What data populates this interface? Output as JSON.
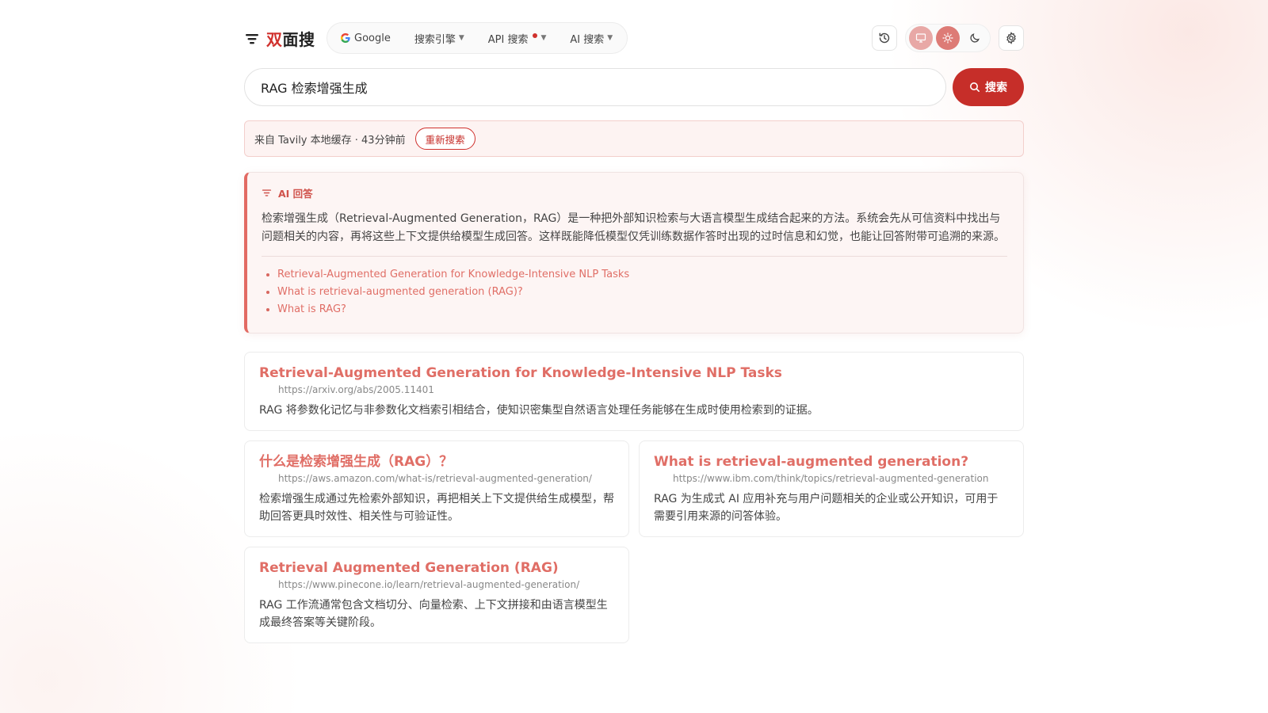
{
  "app": {
    "logo_accent": "双",
    "logo_rest": "面搜"
  },
  "engines": {
    "google": "Google",
    "search_engine": "搜索引擎",
    "api_search": "API 搜索",
    "ai_search": "AI 搜索"
  },
  "search": {
    "query": "RAG 检索增强生成",
    "button_label": "搜索"
  },
  "cache": {
    "text": "来自 Tavily 本地缓存 · 43分钟前",
    "retry_label": "重新搜索"
  },
  "ai_answer": {
    "title": "AI 回答",
    "text": "检索增强生成（Retrieval-Augmented Generation，RAG）是一种把外部知识检索与大语言模型生成结合起来的方法。系统会先从可信资料中找出与问题相关的内容，再将这些上下文提供给模型生成回答。这样既能降低模型仅凭训练数据作答时出现的过时信息和幻觉，也能让回答附带可追溯的来源。",
    "sources": [
      "Retrieval-Augmented Generation for Knowledge-Intensive NLP Tasks",
      "What is retrieval-augmented generation (RAG)?",
      "What is RAG?"
    ]
  },
  "results": [
    {
      "title": "Retrieval-Augmented Generation for Knowledge-Intensive NLP Tasks",
      "url": "https://arxiv.org/abs/2005.11401",
      "snippet": "RAG 将参数化记忆与非参数化文档索引相结合，使知识密集型自然语言处理任务能够在生成时使用检索到的证据。"
    },
    {
      "title": "什么是检索增强生成（RAG）？",
      "url": "https://aws.amazon.com/what-is/retrieval-augmented-generation/",
      "snippet": "检索增强生成通过先检索外部知识，再把相关上下文提供给生成模型，帮助回答更具时效性、相关性与可验证性。"
    },
    {
      "title": "What is retrieval-augmented generation?",
      "url": "https://www.ibm.com/think/topics/retrieval-augmented-generation",
      "snippet": "RAG 为生成式 AI 应用补充与用户问题相关的企业或公开知识，可用于需要引用来源的问答体验。"
    },
    {
      "title": "Retrieval Augmented Generation (RAG)",
      "url": "https://www.pinecone.io/learn/retrieval-augmented-generation/",
      "snippet": "RAG 工作流通常包含文档切分、向量检索、上下文拼接和由语言模型生成最终答案等关键阶段。"
    }
  ],
  "colors": {
    "accent": "#c62e29",
    "link": "#e06e66"
  },
  "icons": [
    "filter-logo-icon",
    "google-icon",
    "history-icon",
    "monitor-icon",
    "sun-icon",
    "moon-icon",
    "gear-icon",
    "search-icon"
  ]
}
